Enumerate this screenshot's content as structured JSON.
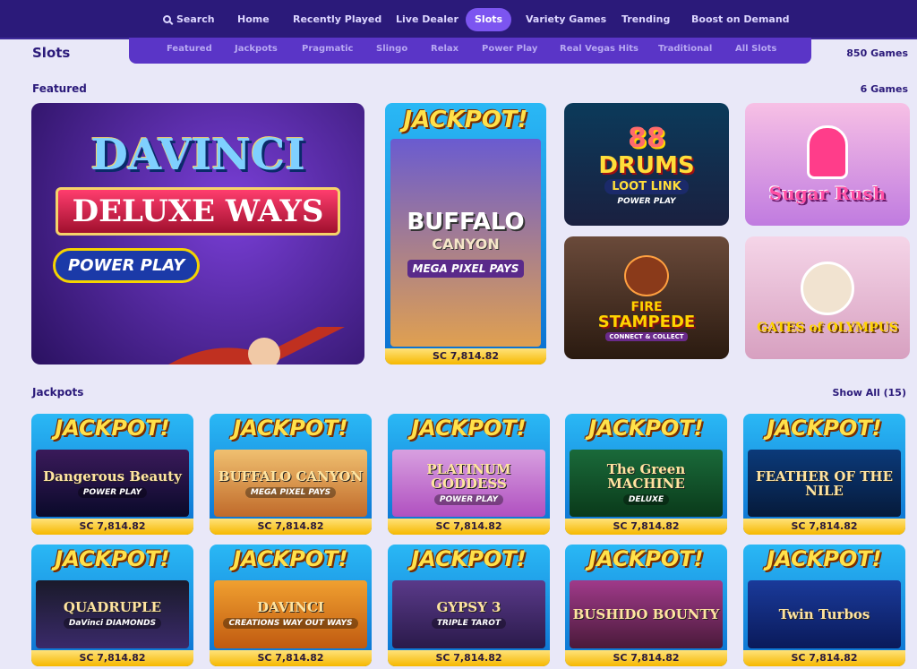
{
  "nav": {
    "search": "Search",
    "home": "Home",
    "recently_played": "Recently Played",
    "live_dealer": "Live Dealer",
    "slots": "Slots",
    "variety_games": "Variety Games",
    "trending": "Trending",
    "boost_on_demand": "Boost on Demand"
  },
  "subnav": {
    "featured": "Featured",
    "jackpots": "Jackpots",
    "pragmatic": "Pragmatic",
    "slingo": "Slingo",
    "relax": "Relax",
    "power_play": "Power Play",
    "real_vegas_hits": "Real Vegas Hits",
    "traditional": "Traditional",
    "all_slots": "All Slots"
  },
  "page": {
    "title": "Slots",
    "count": "850 Games"
  },
  "featured": {
    "title": "Featured",
    "count": "6 Games",
    "davinci": {
      "line1": "DAVINCI",
      "line2": "DELUXE WAYS",
      "badge": "POWER PLAY"
    },
    "buffalo": {
      "jackpot": "JACKPOT!",
      "line1": "BUFFALO",
      "line2": "CANYON",
      "line3": "MEGA PIXEL PAYS",
      "amount": "SC 7,814.82"
    },
    "drums": {
      "line1": "88",
      "line2": "DRUMS",
      "line3": "LOOT LINK",
      "badge": "POWER PLAY"
    },
    "sugar": {
      "name": "Sugar Rush"
    },
    "fire": {
      "line1": "FIRE",
      "line2": "STAMPEDE",
      "line3": "CONNECT & COLLECT"
    },
    "olympus": {
      "name": "GATES of OLYMPUS"
    }
  },
  "jackpots": {
    "title": "Jackpots",
    "show_all": "Show All (15)",
    "tiles": [
      {
        "jackpot": "JACKPOT!",
        "name": "Dangerous Beauty",
        "badge": "POWER PLAY",
        "amount": "SC 7,814.82"
      },
      {
        "jackpot": "JACKPOT!",
        "name": "BUFFALO CANYON",
        "badge": "MEGA PIXEL PAYS",
        "amount": "SC 7,814.82"
      },
      {
        "jackpot": "JACKPOT!",
        "name": "PLATINUM GODDESS",
        "badge": "POWER PLAY",
        "amount": "SC 7,814.82"
      },
      {
        "jackpot": "JACKPOT!",
        "name": "The Green MACHINE",
        "badge": "DELUXE",
        "amount": "SC 7,814.82"
      },
      {
        "jackpot": "JACKPOT!",
        "name": "FEATHER OF THE NILE",
        "badge": "",
        "amount": "SC 7,814.82"
      },
      {
        "jackpot": "JACKPOT!",
        "name": "QUADRUPLE",
        "badge": "DaVinci DIAMONDS",
        "amount": "SC 7,814.82"
      },
      {
        "jackpot": "JACKPOT!",
        "name": "DAVINCI",
        "badge": "CREATIONS WAY OUT WAYS",
        "amount": "SC 7,814.82"
      },
      {
        "jackpot": "JACKPOT!",
        "name": "GYPSY 3",
        "badge": "TRIPLE TAROT",
        "amount": "SC 7,814.82"
      },
      {
        "jackpot": "JACKPOT!",
        "name": "BUSHIDO BOUNTY",
        "badge": "",
        "amount": "SC 7,814.82"
      },
      {
        "jackpot": "JACKPOT!",
        "name": "Twin Turbos",
        "badge": "",
        "amount": "SC 7,814.82"
      }
    ]
  }
}
